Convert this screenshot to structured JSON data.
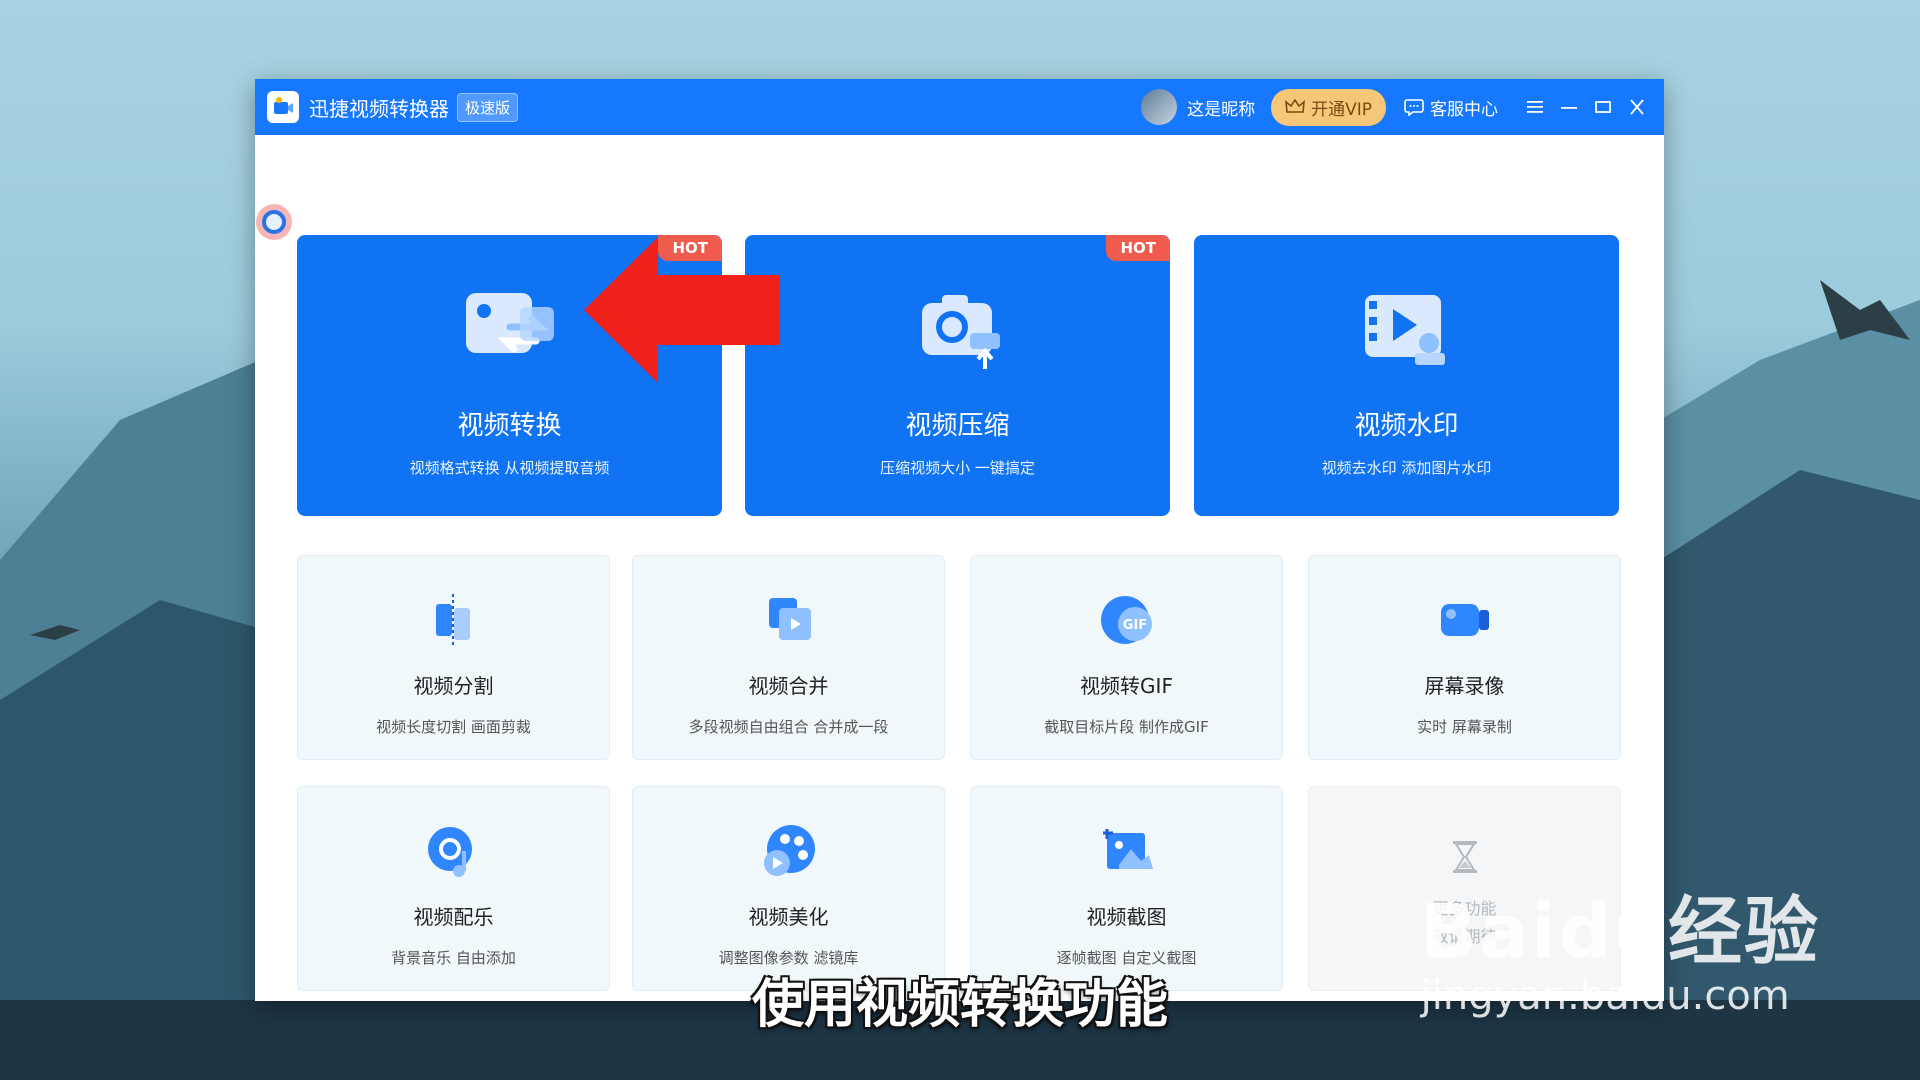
{
  "window": {
    "title": "迅捷视频转换器",
    "edition": "极速版",
    "user_nickname": "这是昵称",
    "vip_label": "开通VIP",
    "service_label": "客服中心"
  },
  "big_cards": [
    {
      "title": "视频转换",
      "subtitle": "视频格式转换 从视频提取音频",
      "badge": "HOT",
      "icon": "video-convert-icon"
    },
    {
      "title": "视频压缩",
      "subtitle": "压缩视频大小 一键搞定",
      "badge": "HOT",
      "icon": "video-compress-icon"
    },
    {
      "title": "视频水印",
      "subtitle": "视频去水印 添加图片水印",
      "badge": "",
      "icon": "video-watermark-icon"
    }
  ],
  "small_cards": [
    {
      "title": "视频分割",
      "subtitle": "视频长度切割 画面剪裁",
      "icon": "video-split-icon"
    },
    {
      "title": "视频合并",
      "subtitle": "多段视频自由组合 合并成一段",
      "icon": "video-merge-icon"
    },
    {
      "title": "视频转GIF",
      "subtitle": "截取目标片段 制作成GIF",
      "icon": "gif-icon",
      "icon_text": "GIF"
    },
    {
      "title": "屏幕录像",
      "subtitle": "实时 屏幕录制",
      "icon": "screen-record-icon"
    },
    {
      "title": "视频配乐",
      "subtitle": "背景音乐 自由添加",
      "icon": "music-icon"
    },
    {
      "title": "视频美化",
      "subtitle": "调整图像参数 滤镜库",
      "icon": "beautify-icon"
    },
    {
      "title": "视频截图",
      "subtitle": "逐帧截图 自定义截图",
      "icon": "screenshot-icon"
    },
    {
      "title": "更多功能",
      "subtitle": "敬请期待",
      "icon": "hourglass-icon",
      "disabled": true
    }
  ],
  "overlay": {
    "caption": "使用视频转换功能",
    "watermark_brand": "Baidu经验",
    "watermark_site": "jingyan.baidu.com"
  },
  "colors": {
    "accent": "#1677ff",
    "card_blue": "#0f73f4",
    "hot_badge": "#ef5b4c",
    "vip_gold": "#f6c779",
    "arrow_red": "#f0201a"
  }
}
